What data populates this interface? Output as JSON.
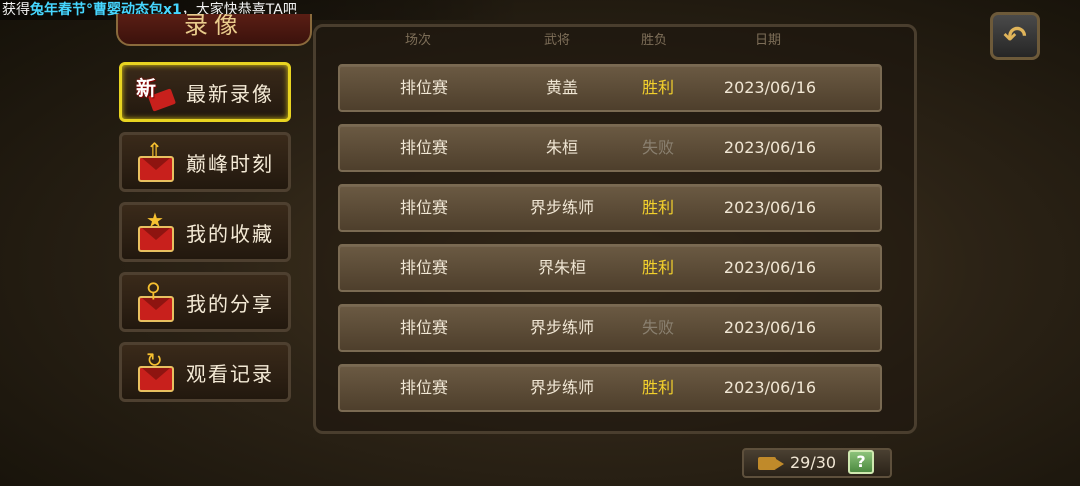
{
  "ticker": {
    "prefix": "获得",
    "highlight": "兔年春节°曹婴动态包x1",
    "suffix": "，大家快恭喜TA吧"
  },
  "title": "录像",
  "back_icon": "back-arrow-icon",
  "menu": [
    {
      "label": "最新录像",
      "icon": "new-envelope-icon",
      "badge": "新",
      "active": true
    },
    {
      "label": "巅峰时刻",
      "icon": "peak-envelope-icon",
      "active": false
    },
    {
      "label": "我的收藏",
      "icon": "star-envelope-icon",
      "active": false
    },
    {
      "label": "我的分享",
      "icon": "share-envelope-icon",
      "active": false
    },
    {
      "label": "观看记录",
      "icon": "history-envelope-icon",
      "active": false
    }
  ],
  "table": {
    "headers": [
      "场次",
      "武将",
      "胜负",
      "日期"
    ],
    "rows": [
      {
        "type": "排位赛",
        "general": "黄盖",
        "result": "胜利",
        "date": "2023/06/16"
      },
      {
        "type": "排位赛",
        "general": "朱桓",
        "result": "失败",
        "date": "2023/06/16"
      },
      {
        "type": "排位赛",
        "general": "界步练师",
        "result": "胜利",
        "date": "2023/06/16"
      },
      {
        "type": "排位赛",
        "general": "界朱桓",
        "result": "胜利",
        "date": "2023/06/16"
      },
      {
        "type": "排位赛",
        "general": "界步练师",
        "result": "失败",
        "date": "2023/06/16"
      },
      {
        "type": "排位赛",
        "general": "界步练师",
        "result": "胜利",
        "date": "2023/06/16"
      }
    ]
  },
  "footer": {
    "count": "29/30",
    "help": "?"
  },
  "colors": {
    "win": "#f3d02c",
    "lose": "#8a8070",
    "active_border": "#e8d421"
  }
}
